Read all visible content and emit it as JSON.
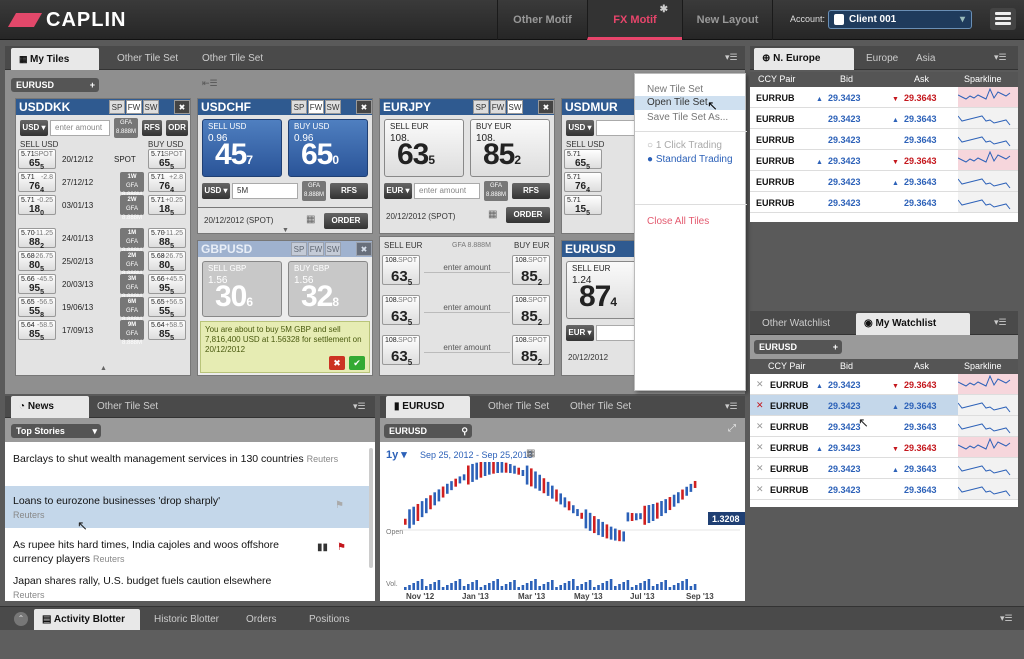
{
  "app": {
    "logo": "CAPLIN",
    "tabs": [
      "Other Motif",
      "FX Motif",
      "New Layout"
    ],
    "active_tab": "FX Motif",
    "account_label": "Account:",
    "account_value": "Client 001"
  },
  "tiles_panel": {
    "tabs": [
      "My Tiles",
      "Other Tile Set",
      "Other Tile Set"
    ],
    "group_chip": "EURUSD"
  },
  "dropdown": {
    "items": [
      "New Tile Set",
      "Open Tile Set",
      "Save Tile Set As...",
      "1 Click Trading",
      "Standard Trading",
      "Close All Tiles"
    ]
  },
  "tiles": {
    "usddkk": {
      "pair": "USDDKK",
      "btns": [
        "SP",
        "FW",
        "SW"
      ],
      "ccy": "USD",
      "amount_ph": "enter amount",
      "gfa": "GFA 8.888M",
      "rfs": "RFS",
      "odr": "ODR",
      "sell": "SELL USD",
      "buy": "BUY USD",
      "rows": [
        {
          "l1": "5.71",
          "l2": "SPOT",
          "lb": "65",
          "ls": "5",
          "date": "20/12/12",
          "tenor": "SPOT",
          "r1": "5.71",
          "r2": "SPOT",
          "rb": "65",
          "rs": "5"
        },
        {
          "l1": "5.71",
          "l2": "-2.8",
          "lb": "76",
          "ls": "4",
          "date": "27/12/12",
          "tenor": "1W",
          "r1": "5.71",
          "r2": "+2.8",
          "rb": "76",
          "rs": "4"
        },
        {
          "l1": "5.71",
          "l2": "-0.25",
          "lb": "18",
          "ls": "0",
          "date": "03/01/13",
          "tenor": "2W",
          "r1": "5.71",
          "r2": "+0.25",
          "rb": "18",
          "rs": "5"
        },
        {
          "l1": "5.70",
          "l2": "-11.25",
          "lb": "88",
          "ls": "2",
          "date": "24/01/13",
          "tenor": "1M",
          "r1": "5.70",
          "r2": "+11.25",
          "rb": "88",
          "rs": "5"
        },
        {
          "l1": "5.68",
          "l2": "-26.75",
          "lb": "80",
          "ls": "5",
          "date": "25/02/13",
          "tenor": "2M",
          "r1": "5.68",
          "r2": "+26.75",
          "rb": "80",
          "rs": "5"
        },
        {
          "l1": "5.66",
          "l2": "-45.5",
          "lb": "95",
          "ls": "5",
          "date": "20/03/13",
          "tenor": "3M",
          "r1": "5.66",
          "r2": "+45.5",
          "rb": "95",
          "rs": "5"
        },
        {
          "l1": "5.65",
          "l2": "-56.5",
          "lb": "55",
          "ls": "8",
          "date": "19/06/13",
          "tenor": "6M",
          "r1": "5.65",
          "r2": "+56.5",
          "rb": "55",
          "rs": "5"
        },
        {
          "l1": "5.64",
          "l2": "-58.5",
          "lb": "85",
          "ls": "5",
          "date": "17/09/13",
          "tenor": "9M",
          "r1": "5.64",
          "r2": "+58.5",
          "rb": "85",
          "rs": "5"
        }
      ]
    },
    "usdchf": {
      "pair": "USDCHF",
      "btns": [
        "SP",
        "FW",
        "SW"
      ],
      "sell": "SELL USD",
      "buy": "BUY USD",
      "sell_sm": "0.96",
      "sell_big": "45",
      "sell_sub": "7",
      "buy_sm": "0.96",
      "buy_big": "65",
      "buy_sub": "0",
      "ccy": "USD",
      "amount": "5M",
      "gfa": "GFA 8.888M",
      "rfs": "RFS",
      "date": "20/12/2012 (SPOT)",
      "order": "ORDER"
    },
    "gbpusd": {
      "pair": "GBPUSD",
      "btns": [
        "SP",
        "FW",
        "SW"
      ],
      "sell": "SELL GBP",
      "buy": "BUY GBP",
      "sell_sm": "1.56",
      "sell_big": "30",
      "sell_sub": "6",
      "buy_sm": "1.56",
      "buy_big": "32",
      "buy_sub": "8",
      "confirm": "You are about to buy 5M GBP and sell 7,816,400 USD at 1.56328 for settlement on 20/12/2012"
    },
    "eurjpy": {
      "pair": "EURJPY",
      "btns": [
        "SP",
        "FW",
        "SW"
      ],
      "sell": "SELL EUR",
      "buy": "BUY EUR",
      "sell_sm": "108.",
      "sell_big": "63",
      "sell_sub": "5",
      "buy_sm": "108.",
      "buy_big": "85",
      "buy_sub": "2",
      "ccy": "EUR",
      "amount_ph": "enter amount",
      "gfa": "GFA 8.888M",
      "rfs": "RFS",
      "date": "20/12/2012 (SPOT)",
      "order": "ORDER",
      "sw_sell": "SELL EUR",
      "sw_gfa": "GFA 8.888M",
      "sw_buy": "BUY EUR",
      "sw_rows": [
        {
          "l1": "108.",
          "l2": "SPOT",
          "lb": "63",
          "ls": "5",
          "amt": "enter amount",
          "r1": "108.",
          "r2": "SPOT",
          "rb": "85",
          "rs": "2"
        },
        {
          "l1": "108.",
          "l2": "SPOT",
          "lb": "63",
          "ls": "5",
          "amt": "enter amount",
          "r1": "108.",
          "r2": "SPOT",
          "rb": "85",
          "rs": "2"
        },
        {
          "l1": "108.",
          "l2": "SPOT",
          "lb": "63",
          "ls": "5",
          "amt": "enter amount",
          "r1": "108.",
          "r2": "SPOT",
          "rb": "85",
          "rs": "2"
        }
      ]
    },
    "usdmur": {
      "pair": "USDMUR",
      "ccy": "USD",
      "sell": "SELL USD",
      "rows": [
        {
          "a": "5.71",
          "b": "65",
          "c": "5"
        },
        {
          "a": "5.71",
          "b": "76",
          "c": "4"
        },
        {
          "a": "5.71",
          "b": "15",
          "c": "5"
        }
      ]
    },
    "eurusd": {
      "pair": "EURUSD",
      "sell": "SELL EUR",
      "sell_sm": "1.24",
      "sell_big": "87",
      "sell_sub": "4",
      "ccy": "EUR",
      "date": "20/12/2012"
    }
  },
  "neurope": {
    "tabs": [
      "N. Europe",
      "Europe",
      "Asia"
    ],
    "headers": [
      "CCY Pair",
      "Bid",
      "Ask",
      "Sparkline"
    ],
    "rows": [
      {
        "pair": "EURRUB",
        "bid": "29.3423",
        "bid_dir": "up",
        "ask": "29.3643",
        "ask_dir": "dn"
      },
      {
        "pair": "EURRUB",
        "bid": "29.3423",
        "bid_dir": "",
        "ask": "29.3643",
        "ask_dir": "up"
      },
      {
        "pair": "EURRUB",
        "bid": "29.3423",
        "bid_dir": "",
        "ask": "29.3643",
        "ask_dir": ""
      },
      {
        "pair": "EURRUB",
        "bid": "29.3423",
        "bid_dir": "up",
        "ask": "29.3643",
        "ask_dir": "dn"
      },
      {
        "pair": "EURRUB",
        "bid": "29.3423",
        "bid_dir": "",
        "ask": "29.3643",
        "ask_dir": "up"
      },
      {
        "pair": "EURRUB",
        "bid": "29.3423",
        "bid_dir": "",
        "ask": "29.3643",
        "ask_dir": ""
      }
    ]
  },
  "watchlist": {
    "tabs": [
      "Other Watchlist",
      "My Watchlist"
    ],
    "chip": "EURUSD",
    "headers": [
      "CCY Pair",
      "Bid",
      "Ask",
      "Sparkline"
    ],
    "rows": [
      {
        "pair": "EURRUB",
        "bid": "29.3423",
        "bid_dir": "up",
        "ask": "29.3643",
        "ask_dir": "dn"
      },
      {
        "pair": "EURRUB",
        "bid": "29.3423",
        "bid_dir": "",
        "ask": "29.3643",
        "ask_dir": "up"
      },
      {
        "pair": "EURRUB",
        "bid": "29.3423",
        "bid_dir": "",
        "ask": "29.3643",
        "ask_dir": ""
      },
      {
        "pair": "EURRUB",
        "bid": "29.3423",
        "bid_dir": "up",
        "ask": "29.3643",
        "ask_dir": "dn"
      },
      {
        "pair": "EURRUB",
        "bid": "29.3423",
        "bid_dir": "",
        "ask": "29.3643",
        "ask_dir": "up"
      },
      {
        "pair": "EURRUB",
        "bid": "29.3423",
        "bid_dir": "",
        "ask": "29.3643",
        "ask_dir": ""
      }
    ]
  },
  "news": {
    "tabs": [
      "News",
      "Other Tile Set"
    ],
    "filter": "Top Stories",
    "items": [
      {
        "headline": "Barclays to shut wealth management services in 130 countries",
        "source": "Reuters"
      },
      {
        "headline": "Loans to eurozone businesses 'drop sharply'",
        "source": "Reuters"
      },
      {
        "headline": "As rupee hits hard times, India cajoles and woos offshore currency players",
        "source": "Reuters"
      },
      {
        "headline": "Japan shares rally, U.S. budget fuels caution elsewhere",
        "source": "Reuters"
      }
    ]
  },
  "chart": {
    "tabs": [
      "EURUSD",
      "Other Tile Set",
      "Other Tile Set"
    ],
    "symbol": "EURUSD",
    "period": "1y",
    "range": "Sep 25, 2012 - Sep 25,2013",
    "open_label": "Open",
    "vol_label": "Vol.",
    "last_price": "1.3208",
    "xlabels": [
      "Nov '12",
      "Jan '13",
      "Mar '13",
      "May '13",
      "Jul '13",
      "Sep '13"
    ]
  },
  "blotter": {
    "tabs": [
      "Activity Blotter",
      "Historic Blotter",
      "Orders",
      "Positions"
    ]
  },
  "colors": {
    "accent": "#e8456b",
    "tile_header": "#2f5a90",
    "up": "#2c61b8",
    "down": "#c4161c"
  }
}
